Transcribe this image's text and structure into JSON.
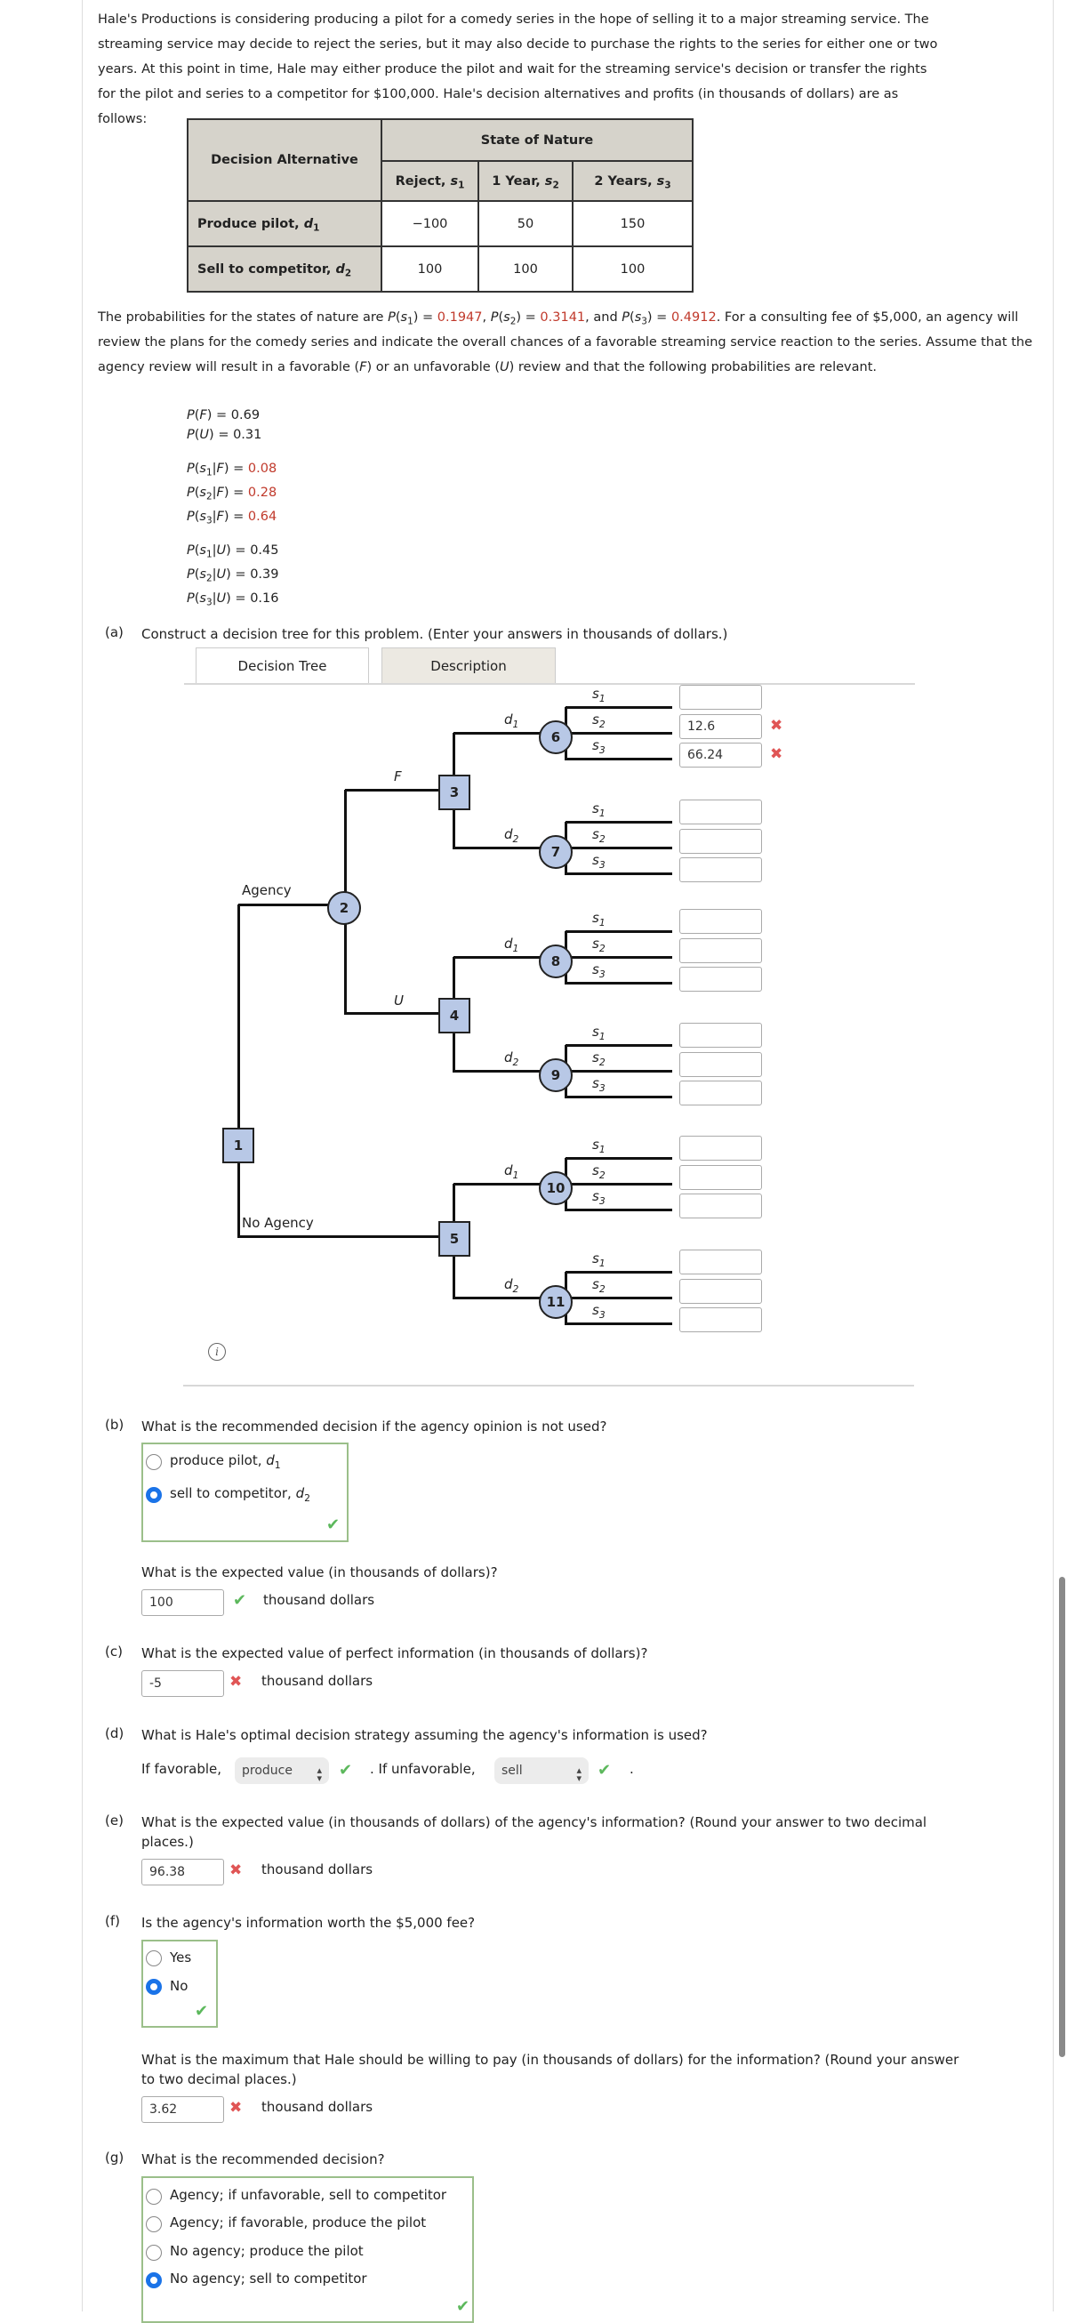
{
  "intro_lines": [
    "Hale's Productions is considering producing a pilot for a comedy series in the hope of selling it to a major streaming service. The",
    "streaming service may decide to reject the series, but it may also decide to purchase the rights to the series for either one or two",
    "years. At this point in time, Hale may either produce the pilot and wait for the streaming service's decision or transfer the rights",
    "for the pilot and series to a competitor for $100,000. Hale's decision alternatives and profits (in thousands of dollars) are as",
    "follows:"
  ],
  "table": {
    "corner": "Decision Alternative",
    "group_header": "State of Nature",
    "columns": [
      {
        "name": "Reject, ",
        "var": "s",
        "sub": "1"
      },
      {
        "name": "1 Year, ",
        "var": "s",
        "sub": "2"
      },
      {
        "name": "2 Years, ",
        "var": "s",
        "sub": "3"
      }
    ],
    "rows": [
      {
        "name": "Produce pilot, ",
        "var": "d",
        "sub": "1",
        "values": [
          "−100",
          "50",
          "150"
        ]
      },
      {
        "name": "Sell to competitor, ",
        "var": "d",
        "sub": "2",
        "values": [
          "100",
          "100",
          "100"
        ]
      }
    ]
  },
  "para2": {
    "t1": "The probabilities for the states of nature are ",
    "p1": "0.1947",
    "p2": "0.3141",
    "p3": "0.4912",
    "t2": ". For a consulting fee of $5,000, an agency will review the plans for the comedy series and indicate the overall chances of a favorable streaming service reaction to the series. Assume that the agency review will result in a favorable (",
    "F": "F",
    "t3": ") or an unfavorable (",
    "U": "U",
    "t4": ") review and that the following probabilities are relevant.",
    "sep_and": ", and "
  },
  "probs": {
    "PF": "0.69",
    "PU": "0.31",
    "given_F": [
      "0.08",
      "0.28",
      "0.64"
    ],
    "given_U": [
      "0.45",
      "0.39",
      "0.16"
    ]
  },
  "part_a": {
    "label": "(a)",
    "question": "Construct a decision tree for this problem. (Enter your answers in thousands of dollars.)",
    "tabs": [
      "Decision Tree",
      "Description"
    ],
    "tree": {
      "decision_nodes": [
        "1",
        "3",
        "4",
        "5"
      ],
      "chance_nodes": [
        "2",
        "6",
        "7",
        "8",
        "9",
        "10",
        "11"
      ],
      "branch_agency": "Agency",
      "branch_no_agency": "No Agency",
      "branch_F": "F",
      "branch_U": "U",
      "decision_var": "d",
      "state_var": "s",
      "inputs": [
        "",
        "12.6",
        "66.24",
        "",
        "",
        "",
        "",
        "",
        "",
        "",
        "",
        "",
        "",
        "",
        "",
        "",
        "",
        ""
      ],
      "input_status": [
        "",
        "incorrect",
        "incorrect",
        "",
        "",
        "",
        "",
        "",
        "",
        "",
        "",
        "",
        "",
        "",
        "",
        "",
        "",
        ""
      ]
    }
  },
  "part_b": {
    "label": "(b)",
    "question": "What is the recommended decision if the agency opinion is not used?",
    "options": [
      {
        "text": "produce pilot, ",
        "var": "d",
        "sub": "1",
        "selected": false
      },
      {
        "text": "sell to competitor, ",
        "var": "d",
        "sub": "2",
        "selected": true
      }
    ],
    "status": "correct",
    "ev_question": "What is the expected value (in thousands of dollars)?",
    "ev_value": "100",
    "ev_status": "correct",
    "unit": "thousand dollars"
  },
  "part_c": {
    "label": "(c)",
    "question": "What is the expected value of perfect information (in thousands of dollars)?",
    "value": "-5",
    "status": "incorrect",
    "unit": "thousand dollars"
  },
  "part_d": {
    "label": "(d)",
    "question": "What is Hale's optimal decision strategy assuming the agency's information is used?",
    "fav_prefix": "If favorable,",
    "fav_value": "produce",
    "fav_status": "correct",
    "unfav_prefix": ". If unfavorable,",
    "unfav_value": "sell",
    "unfav_status": "correct",
    "suffix": "."
  },
  "part_e": {
    "label": "(e)",
    "question_l1": "What is the expected value (in thousands of dollars) of the agency's information? (Round your answer to two decimal",
    "question_l2": "places.)",
    "value": "96.38",
    "status": "incorrect",
    "unit": "thousand dollars"
  },
  "part_f": {
    "label": "(f)",
    "question": "Is the agency's information worth the $5,000 fee?",
    "options": [
      {
        "text": "Yes",
        "selected": false
      },
      {
        "text": "No",
        "selected": true
      }
    ],
    "status": "correct",
    "max_question_l1": "What is the maximum that Hale should be willing to pay (in thousands of dollars) for the information? (Round your answer",
    "max_question_l2": "to two decimal places.)",
    "max_value": "3.62",
    "max_status": "incorrect",
    "unit": "thousand dollars"
  },
  "part_g": {
    "label": "(g)",
    "question": "What is the recommended decision?",
    "options": [
      {
        "text": "Agency; if unfavorable, sell to competitor",
        "selected": false
      },
      {
        "text": "Agency; if favorable, produce the pilot",
        "selected": false
      },
      {
        "text": "No agency; produce the pilot",
        "selected": false
      },
      {
        "text": "No agency; sell to competitor",
        "selected": true
      }
    ],
    "status": "correct"
  },
  "icons": {
    "correct": "check-icon",
    "incorrect": "x-icon",
    "info": "info-icon",
    "select": "chevron-up-down-icon"
  },
  "colors": {
    "accent_red": "#c0392b",
    "node_fill": "#b8c8e6",
    "correct": "#5cb85c",
    "incorrect": "#e05555",
    "radio_selected": "#1a73e8"
  }
}
